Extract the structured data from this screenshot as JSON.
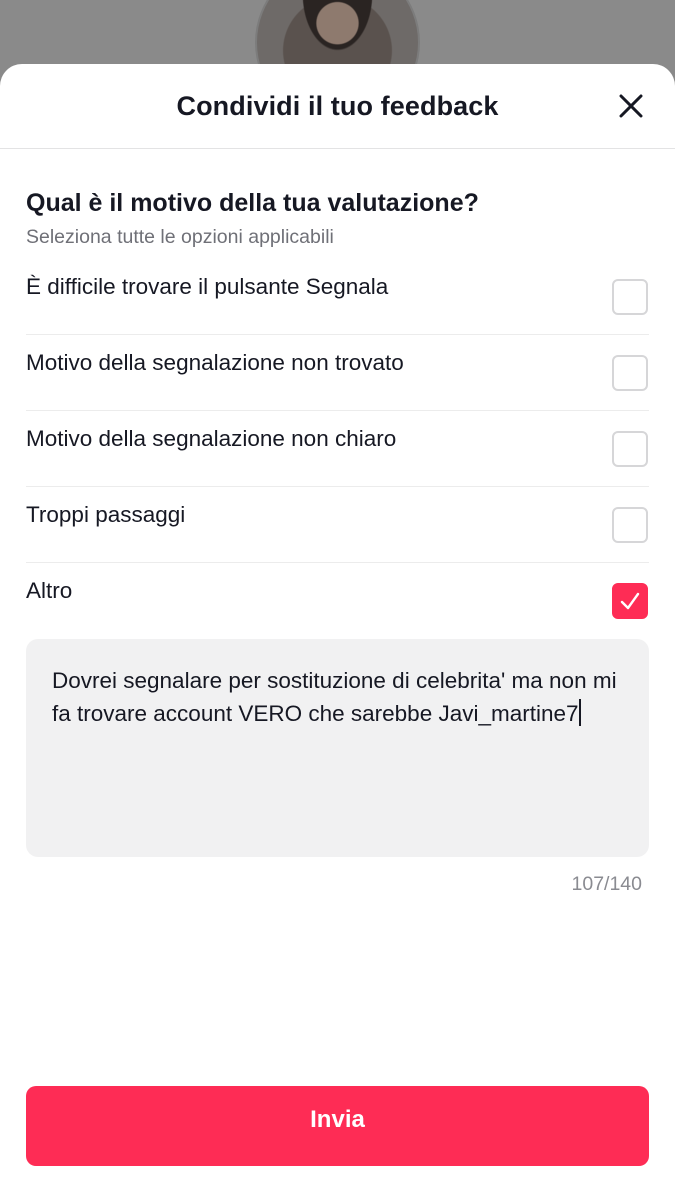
{
  "header": {
    "title": "Condividi il tuo feedback",
    "close_icon": "close-icon"
  },
  "question": {
    "title": "Qual è il motivo della tua valutazione?",
    "subtitle": "Seleziona tutte le opzioni applicabili"
  },
  "options": [
    {
      "label": "È difficile trovare il pulsante Segnala",
      "checked": false
    },
    {
      "label": "Motivo della segnalazione non trovato",
      "checked": false
    },
    {
      "label": "Motivo della segnalazione non chiaro",
      "checked": false
    },
    {
      "label": "Troppi passaggi",
      "checked": false
    },
    {
      "label": "Altro",
      "checked": true
    }
  ],
  "feedback": {
    "value": "Dovrei segnalare per sostituzione di celebrita' ma non mi fa trovare account VERO che sarebbe Javi_martine7",
    "counter": "107/140"
  },
  "submit": {
    "label": "Invia"
  },
  "colors": {
    "accent": "#fe2c55",
    "text": "#161823",
    "muted": "#6f7077",
    "field_bg": "#f1f1f2"
  }
}
